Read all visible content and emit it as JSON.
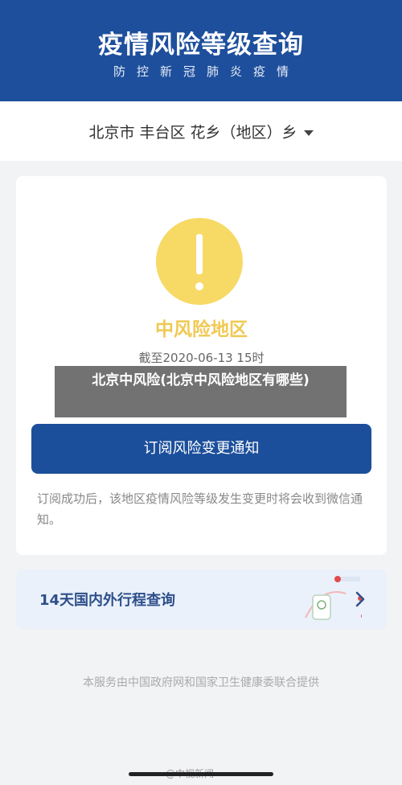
{
  "header": {
    "title": "疫情风险等级查询",
    "subtitle": "防控新冠肺炎疫情"
  },
  "region": {
    "text": "北京市 丰台区 花乡（地区）乡"
  },
  "risk_card": {
    "level": "中风险地区",
    "time": "截至2020-06-13 15时",
    "subscribe_button": "订阅风险变更通知",
    "note": "订阅成功后，该地区疫情风险等级发生变更时将会收到微信通知。"
  },
  "trip_card": {
    "label": "14天国内外行程查询"
  },
  "footer": {
    "text": "本服务由中国政府网和国家卫生健康委联合提供"
  },
  "overlay": {
    "caption": "北京中风险(北京中风险地区有哪些)"
  },
  "watermark": {
    "text": "@中视新闻"
  },
  "colors": {
    "header_bg": "#1e4f9c",
    "button_bg": "#1c4f9b",
    "risk_yellow": "#f7d966",
    "risk_text": "#efc954"
  },
  "icons": {
    "risk": "exclamation-icon",
    "dropdown": "caret-down-icon",
    "trip": "chevron-right-icon"
  }
}
